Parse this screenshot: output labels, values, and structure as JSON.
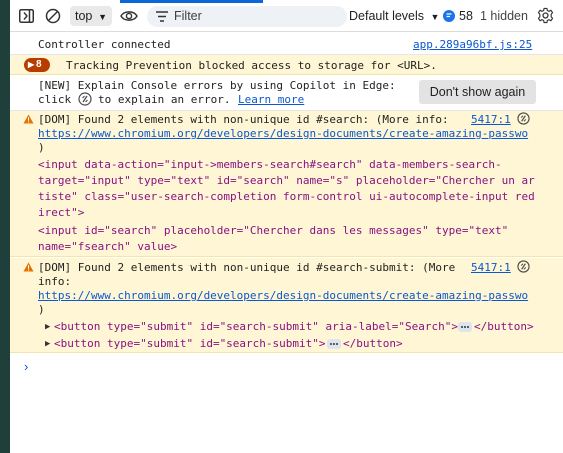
{
  "toolbar": {
    "context": "top",
    "filter_placeholder": "Filter",
    "levels_label": "Default levels",
    "issues_count": "58",
    "hidden_label": "1 hidden",
    "accent_color": "#0b66d8"
  },
  "messages": {
    "controller": {
      "text": "Controller connected",
      "source": "app.289a96bf.js:25"
    },
    "tracking": {
      "count": "8",
      "text": "Tracking Prevention blocked access to storage for <URL>."
    },
    "copilot": {
      "line1": "[NEW] Explain Console errors by using Copilot in Edge:",
      "line2_a": "click",
      "line2_b": "to explain an error.",
      "learn_more": "Learn more",
      "button": "Don't show again"
    },
    "dom_search": {
      "header": "[DOM] Found 2 elements with non-unique id #search: (More info:",
      "source": "5417:1",
      "url": "https://www.chromium.org/developers/design-documents/create-amazing-passwo",
      "close_paren": ")",
      "el1_lines": [
        "<input data-action=\"input->members-search#search\" data-members-search-",
        "target=\"input\" type=\"text\" id=\"search\" name=\"s\" placeholder=\"Chercher un ar",
        "tiste\" class=\"user-search-completion form-control ui-autocomplete-input red",
        "irect\">"
      ],
      "el2_lines": [
        "<input id=\"search\" placeholder=\"Chercher dans les messages\" type=\"text\"",
        "name=\"fsearch\" value>"
      ]
    },
    "dom_submit": {
      "header_line1": "[DOM] Found 2 elements with non-unique id #search-submit: (More",
      "header_line2": "info:",
      "source": "5417:1",
      "url": "https://www.chromium.org/developers/design-documents/create-amazing-passwo",
      "close_paren": ")",
      "el1_open": "<button type=\"submit\" id=\"search-submit\" aria-label=\"Search\">",
      "el1_close": "</button>",
      "el2_open": "<button type=\"submit\" id=\"search-submit\">",
      "el2_close": "</button>"
    },
    "prompt": "›"
  }
}
